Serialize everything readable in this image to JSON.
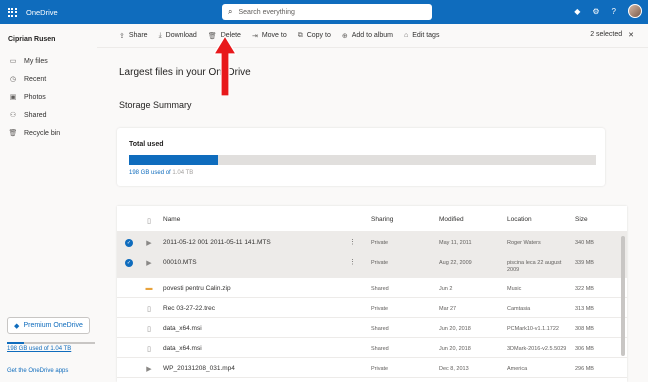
{
  "app": {
    "title": "OneDrive"
  },
  "search": {
    "placeholder": "Search everything"
  },
  "user": {
    "name": "Ciprian Rusen"
  },
  "nav": [
    {
      "label": "My files",
      "icon": "folder-icon"
    },
    {
      "label": "Recent",
      "icon": "clock-icon"
    },
    {
      "label": "Photos",
      "icon": "image-icon"
    },
    {
      "label": "Shared",
      "icon": "people-icon"
    },
    {
      "label": "Recycle bin",
      "icon": "trash-icon"
    }
  ],
  "premium": {
    "label": "Premium OneDrive"
  },
  "storage": {
    "text": "198 GB used of 1.04 TB",
    "used_fraction": 0.19
  },
  "apps_link": "Get the OneDrive apps",
  "commands": [
    {
      "label": "Share",
      "icon": "share-icon"
    },
    {
      "label": "Download",
      "icon": "download-icon"
    },
    {
      "label": "Delete",
      "icon": "trash-icon"
    },
    {
      "label": "Move to",
      "icon": "move-icon"
    },
    {
      "label": "Copy to",
      "icon": "copy-icon"
    },
    {
      "label": "Add to album",
      "icon": "album-icon"
    },
    {
      "label": "Edit tags",
      "icon": "tag-icon"
    }
  ],
  "selection": {
    "text": "2 selected"
  },
  "page": {
    "heading": "Largest files in your OneDrive",
    "subheading": "Storage Summary"
  },
  "summary": {
    "title": "Total used",
    "used": "198 GB used of",
    "total": "1.04 TB",
    "fraction": 0.19
  },
  "table": {
    "columns": [
      "Name",
      "Sharing",
      "Modified",
      "Location",
      "Size"
    ],
    "rows": [
      {
        "selected": true,
        "type": "video",
        "name": "2011-05-12 001 2011-05-11 141.MTS",
        "sharing": "Private",
        "modified": "May 11, 2011",
        "location": "Roger Waters",
        "size": "340 MB"
      },
      {
        "selected": true,
        "type": "video",
        "name": "00010.MTS",
        "sharing": "Private",
        "modified": "Aug 22, 2009",
        "location": "piscina leca 22 august 2009",
        "size": "339 MB"
      },
      {
        "selected": false,
        "type": "zip",
        "name": "povesti pentru Calin.zip",
        "sharing": "Shared",
        "modified": "Jun 2",
        "location": "Music",
        "size": "322 MB"
      },
      {
        "selected": false,
        "type": "file",
        "name": "Rec 03-27-22.trec",
        "sharing": "Private",
        "modified": "Mar 27",
        "location": "Camtasia",
        "size": "313 MB"
      },
      {
        "selected": false,
        "type": "file",
        "name": "data_x64.msi",
        "sharing": "Shared",
        "modified": "Jun 20, 2018",
        "location": "PCMark10-v1.1.1722",
        "size": "308 MB"
      },
      {
        "selected": false,
        "type": "file",
        "name": "data_x64.msi",
        "sharing": "Shared",
        "modified": "Jun 20, 2018",
        "location": "3DMark-2016-v2.5.5029",
        "size": "306 MB"
      },
      {
        "selected": false,
        "type": "video",
        "name": "WP_20131208_031.mp4",
        "sharing": "Private",
        "modified": "Dec 8, 2013",
        "location": "America",
        "size": "296 MB"
      }
    ]
  },
  "colors": {
    "accent": "#0f6cbd",
    "annotation": "#e8191b"
  }
}
